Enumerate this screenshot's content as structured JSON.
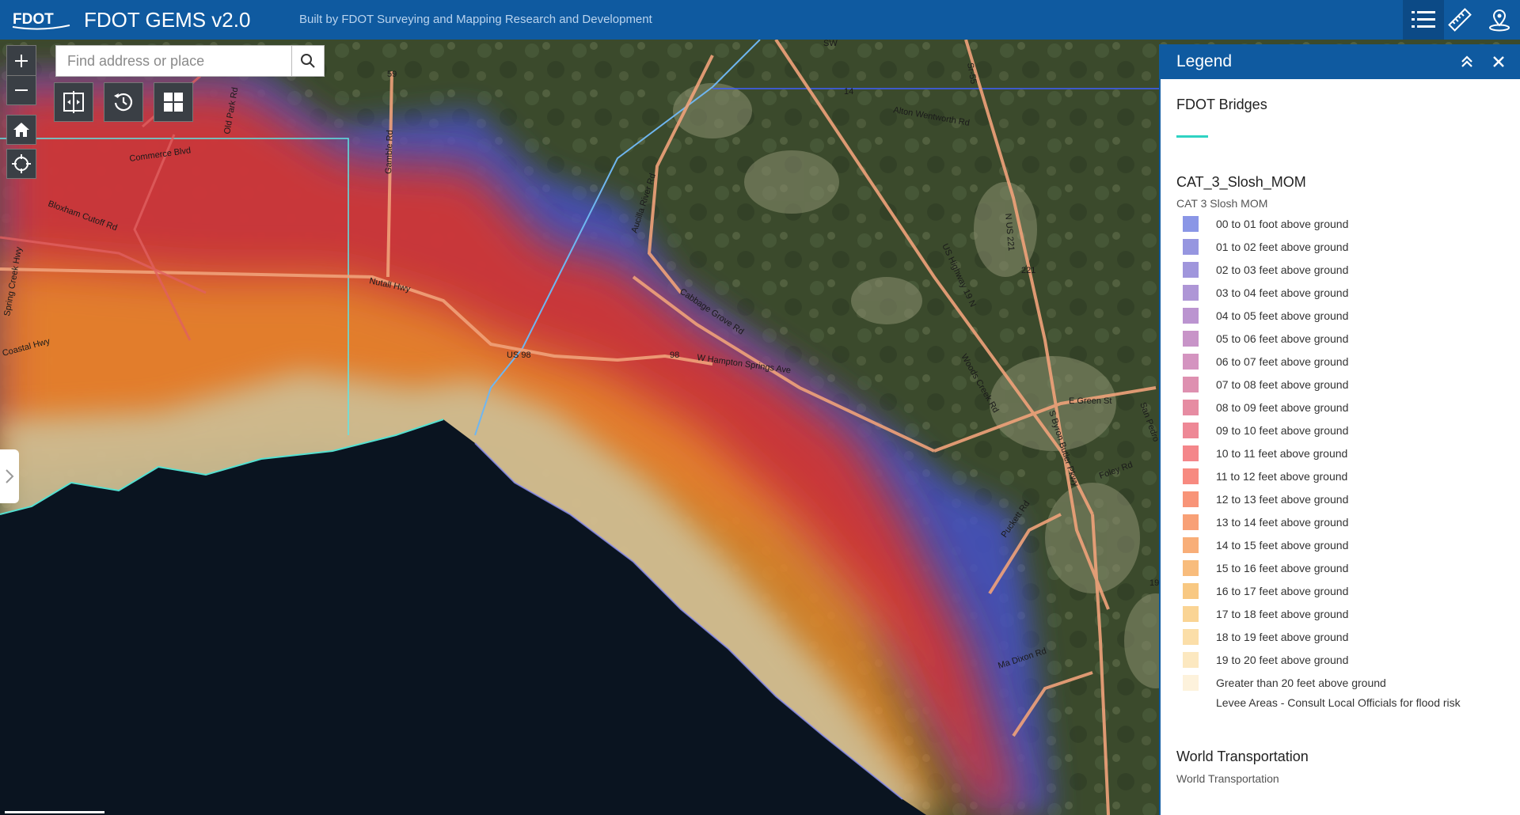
{
  "header": {
    "logo_text": "FDOT",
    "title": "FDOT GEMS v2.0",
    "subtitle": "Built by FDOT Surveying and Mapping Research and Development",
    "buttons": [
      "legend-list-icon",
      "measure-ruler-icon",
      "locate-pin-icon"
    ]
  },
  "search": {
    "placeholder": "Find address or place",
    "value": ""
  },
  "map_labels": [
    "SW",
    "Sr-55",
    "59",
    "14",
    "Alton Wentworth Rd",
    "Commerce Blvd",
    "Bloxham Cutoff Rd",
    "Gamble Rd",
    "Aucilla River Rd",
    "Nutall Hwy",
    "Cabbage Grove Rd",
    "US 98",
    "98",
    "W Hampton Springs Ave",
    "US Highway 19 N",
    "N US 221",
    "221",
    "Woods Creek Rd",
    "E Green St",
    "S Byron Butler Pkwy",
    "Foley Rd",
    "Puckett Rd",
    "Ma Dixon Rd",
    "19",
    "Old Park Rd",
    "Spring Creek Hwy",
    "Coastal Hwy",
    "San Pedro"
  ],
  "legend": {
    "title": "Legend",
    "layer1": {
      "title": "FDOT Bridges",
      "color": "#2fd3c3"
    },
    "layer2": {
      "title": "CAT_3_Slosh_MOM",
      "subtitle": "CAT 3 Slosh MOM",
      "items": [
        {
          "label": "00 to 01 foot above ground",
          "color": "#8a96e6"
        },
        {
          "label": "01 to 02 feet above ground",
          "color": "#9696e0"
        },
        {
          "label": "02 to 03 feet above ground",
          "color": "#a096dc"
        },
        {
          "label": "03 to 04 feet above ground",
          "color": "#ae96d6"
        },
        {
          "label": "04 to 05 feet above ground",
          "color": "#bb94d0"
        },
        {
          "label": "05 to 06 feet above ground",
          "color": "#c894c8"
        },
        {
          "label": "06 to 07 feet above ground",
          "color": "#d494c0"
        },
        {
          "label": "07 to 08 feet above ground",
          "color": "#de90b0"
        },
        {
          "label": "08 to 09 feet above ground",
          "color": "#e68ca2"
        },
        {
          "label": "09 to 10 feet above ground",
          "color": "#ee8896"
        },
        {
          "label": "10 to 11 feet above ground",
          "color": "#f4868a"
        },
        {
          "label": "11 to 12 feet above ground",
          "color": "#f78a80"
        },
        {
          "label": "12 to 13 feet above ground",
          "color": "#f89478"
        },
        {
          "label": "13 to 14 feet above ground",
          "color": "#f8a076"
        },
        {
          "label": "14 to 15 feet above ground",
          "color": "#f8ae78"
        },
        {
          "label": "15 to 16 feet above ground",
          "color": "#f8bc7c"
        },
        {
          "label": "16 to 17 feet above ground",
          "color": "#f8c882"
        },
        {
          "label": "17 to 18 feet above ground",
          "color": "#fad494"
        },
        {
          "label": "18 to 19 feet above ground",
          "color": "#fbdea8"
        },
        {
          "label": "19 to 20 feet above ground",
          "color": "#fce8c0"
        },
        {
          "label": "Greater than 20 feet above ground",
          "color": "#fdf2dc"
        }
      ],
      "levee": "Levee Areas - Consult Local Officials for flood risk"
    },
    "layer3": {
      "title": "World Transportation",
      "subtitle": "World Transportation"
    }
  }
}
